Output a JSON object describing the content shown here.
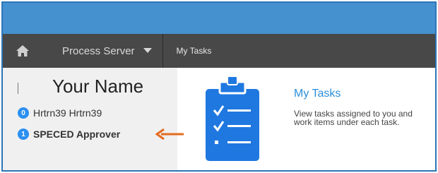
{
  "colors": {
    "top_bar": "#4591cf",
    "nav_bar": "#484848",
    "sidebar": "#f0f0f0",
    "badge": "#2b8ff0",
    "accent": "#2b8fd9",
    "annotation_arrow": "#e36c1e",
    "frame_border": "#2e75b6"
  },
  "nav": {
    "home_icon": "home-icon",
    "process_server_label": "Process Server",
    "dropdown_icon": "caret-down-icon",
    "my_tasks_label": "My Tasks"
  },
  "sidebar": {
    "name_placeholder": "Your Name",
    "users": [
      {
        "badge": "0",
        "label": "Hrtrn39 Hrtrn39"
      },
      {
        "badge": "1",
        "label": "SPECED Approver"
      }
    ]
  },
  "annotation": {
    "arrow_icon": "arrow-left-icon"
  },
  "main": {
    "task_icon": "clipboard-checklist-icon",
    "title": "My Tasks",
    "description": "View tasks assigned to you and work items under each task."
  }
}
